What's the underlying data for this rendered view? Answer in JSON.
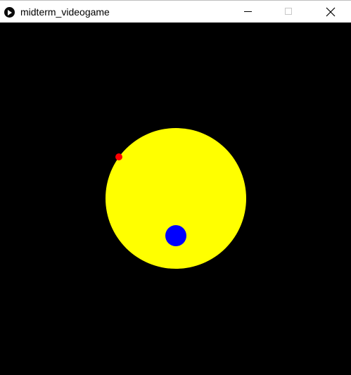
{
  "window": {
    "title": "midterm_videogame",
    "app_icon": "processing-play-icon",
    "controls": {
      "minimize_icon": "minimize-icon",
      "maximize_icon": "maximize-icon",
      "close_icon": "close-icon"
    }
  },
  "canvas": {
    "background_color": "#000000",
    "sprites": {
      "sun": {
        "color": "#ffff00"
      },
      "player": {
        "color": "#0000ff"
      },
      "enemy": {
        "color": "#ff0000"
      }
    }
  }
}
